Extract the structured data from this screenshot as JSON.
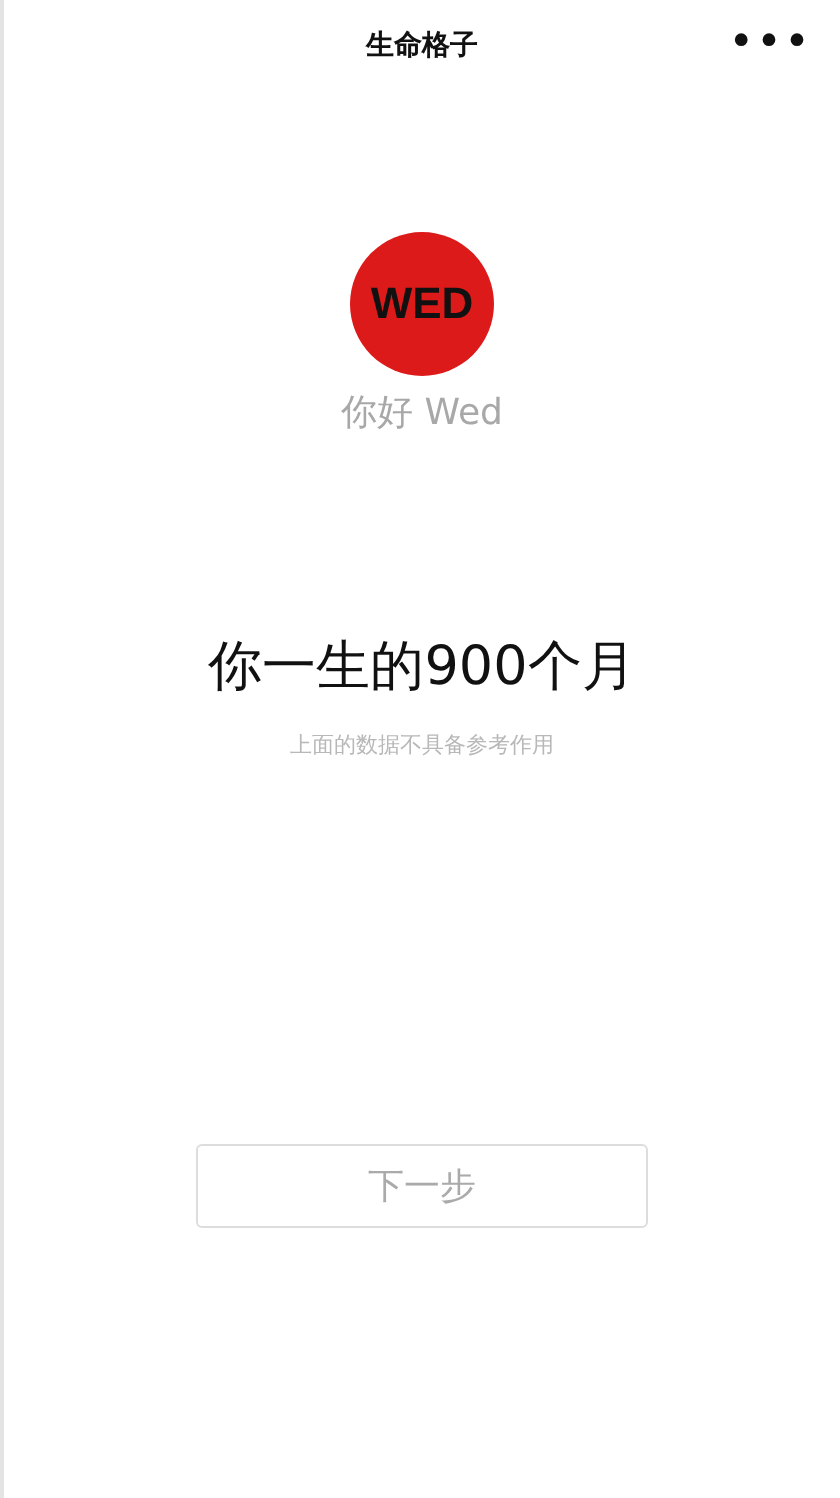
{
  "nav_bar": {
    "title": "生命格子",
    "menu_icon": "•••"
  },
  "profile": {
    "avatar_text": "WED",
    "greeting": "你好 Wed"
  },
  "headline": "你一生的900个月",
  "note": "上面的数据不具备参考作用",
  "next_button": {
    "label": "下一步",
    "disabled": true
  }
}
